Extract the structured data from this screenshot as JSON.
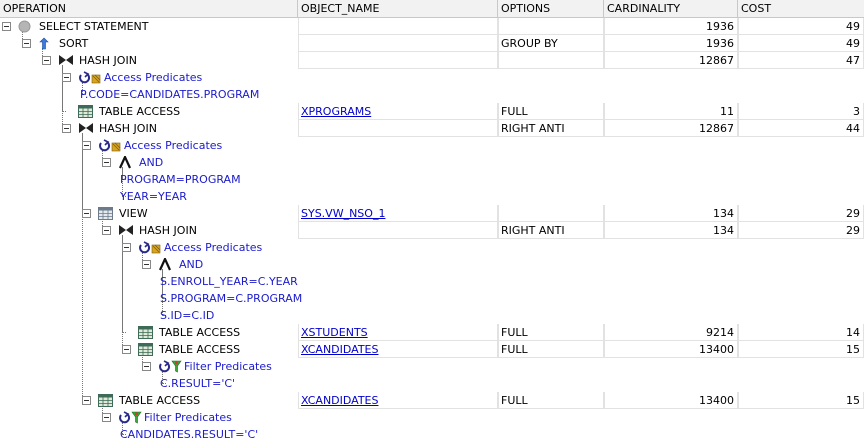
{
  "columns": [
    "OPERATION",
    "OBJECT_NAME",
    "OPTIONS",
    "CARDINALITY",
    "COST"
  ],
  "rows": [
    {
      "level": 0,
      "toggle": true,
      "icon": "select-statement-icon",
      "label": "SELECT STATEMENT",
      "object": "",
      "options": "",
      "cardinality": "1936",
      "cost": "49",
      "kind": "op"
    },
    {
      "level": 1,
      "toggle": true,
      "icon": "sort-icon",
      "label": "SORT",
      "object": "",
      "options": "GROUP BY",
      "cardinality": "1936",
      "cost": "49",
      "kind": "op"
    },
    {
      "level": 2,
      "toggle": true,
      "icon": "hash-join-icon",
      "label": "HASH JOIN",
      "object": "",
      "options": "",
      "cardinality": "12867",
      "cost": "47",
      "kind": "op"
    },
    {
      "level": 3,
      "toggle": true,
      "icon": "access-predicates-icon",
      "label": "Access Predicates",
      "kind": "pred"
    },
    {
      "level": 4,
      "toggle": false,
      "icon": "",
      "label": "P.CODE=CANDIDATES.PROGRAM",
      "kind": "predtext"
    },
    {
      "level": 3,
      "toggle": false,
      "icon": "table-access-icon",
      "label": "TABLE ACCESS",
      "object": "XPROGRAMS",
      "options": "FULL",
      "cardinality": "11",
      "cost": "3",
      "kind": "op"
    },
    {
      "level": 3,
      "toggle": true,
      "icon": "hash-join-icon",
      "label": "HASH JOIN",
      "object": "",
      "options": "RIGHT ANTI",
      "cardinality": "12867",
      "cost": "44",
      "kind": "op"
    },
    {
      "level": 4,
      "toggle": true,
      "icon": "access-predicates-icon",
      "label": "Access Predicates",
      "kind": "pred"
    },
    {
      "level": 5,
      "toggle": true,
      "icon": "and-icon",
      "label": "AND",
      "kind": "pred"
    },
    {
      "level": 6,
      "toggle": false,
      "icon": "",
      "label": "PROGRAM=PROGRAM",
      "kind": "predtext"
    },
    {
      "level": 6,
      "toggle": false,
      "icon": "",
      "label": "YEAR=YEAR",
      "kind": "predtext"
    },
    {
      "level": 4,
      "toggle": true,
      "icon": "view-icon",
      "label": "VIEW",
      "object": "SYS.VW_NSO_1",
      "options": "",
      "cardinality": "134",
      "cost": "29",
      "kind": "op"
    },
    {
      "level": 5,
      "toggle": true,
      "icon": "hash-join-icon",
      "label": "HASH JOIN",
      "object": "",
      "options": "RIGHT ANTI",
      "cardinality": "134",
      "cost": "29",
      "kind": "op"
    },
    {
      "level": 6,
      "toggle": true,
      "icon": "access-predicates-icon",
      "label": "Access Predicates",
      "kind": "pred"
    },
    {
      "level": 7,
      "toggle": true,
      "icon": "and-icon",
      "label": "AND",
      "kind": "pred"
    },
    {
      "level": 8,
      "toggle": false,
      "icon": "",
      "label": "S.ENROLL_YEAR=C.YEAR",
      "kind": "predtext"
    },
    {
      "level": 8,
      "toggle": false,
      "icon": "",
      "label": "S.PROGRAM=C.PROGRAM",
      "kind": "predtext"
    },
    {
      "level": 8,
      "toggle": false,
      "icon": "",
      "label": "S.ID=C.ID",
      "kind": "predtext"
    },
    {
      "level": 6,
      "toggle": false,
      "icon": "table-access-icon",
      "label": "TABLE ACCESS",
      "object": "XSTUDENTS",
      "options": "FULL",
      "cardinality": "9214",
      "cost": "14",
      "kind": "op"
    },
    {
      "level": 6,
      "toggle": true,
      "icon": "table-access-icon",
      "label": "TABLE ACCESS",
      "object": "XCANDIDATES",
      "options": "FULL",
      "cardinality": "13400",
      "cost": "15",
      "kind": "op"
    },
    {
      "level": 7,
      "toggle": true,
      "icon": "filter-predicates-icon",
      "label": "Filter Predicates",
      "kind": "pred"
    },
    {
      "level": 8,
      "toggle": false,
      "icon": "",
      "label": "C.RESULT='C'",
      "kind": "predtext"
    },
    {
      "level": 4,
      "toggle": true,
      "icon": "table-access-icon",
      "label": "TABLE ACCESS",
      "object": "XCANDIDATES",
      "options": "FULL",
      "cardinality": "13400",
      "cost": "15",
      "kind": "op"
    },
    {
      "level": 5,
      "toggle": true,
      "icon": "filter-predicates-icon",
      "label": "Filter Predicates",
      "kind": "pred"
    },
    {
      "level": 6,
      "toggle": false,
      "icon": "",
      "label": "CANDIDATES.RESULT='C'",
      "kind": "predtext"
    }
  ]
}
